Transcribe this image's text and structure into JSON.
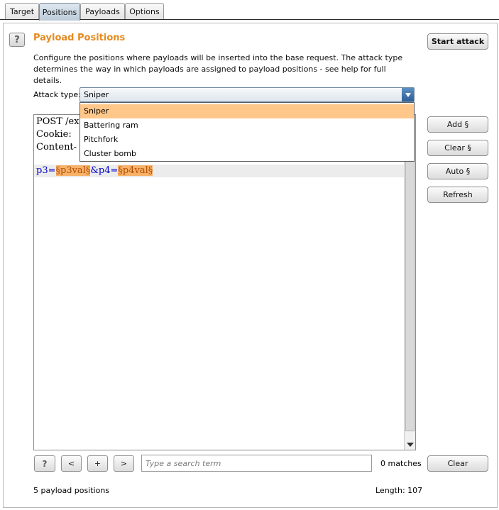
{
  "tabs": [
    {
      "label": "Target",
      "active": false
    },
    {
      "label": "Positions",
      "active": true
    },
    {
      "label": "Payloads",
      "active": false
    },
    {
      "label": "Options",
      "active": false
    }
  ],
  "panel": {
    "help_glyph": "?",
    "title": "Payload Positions",
    "description": "Configure the positions where payloads will be inserted into the base request. The attack type determines the way in which payloads are assigned to payload positions - see help for full details.",
    "start_attack_label": "Start attack"
  },
  "attack_type": {
    "label": "Attack type:",
    "selected": "Sniper",
    "options": [
      "Sniper",
      "Battering ram",
      "Pitchfork",
      "Cluster bomb"
    ]
  },
  "editor": {
    "lines": [
      "POST /ex",
      "Cookie:",
      "Content-"
    ],
    "param_line": {
      "p3_name": "p3=",
      "p3_value": "§p3val§",
      "p4_name": "&p4=",
      "p4_value": "§p4val§"
    }
  },
  "side_buttons": {
    "add": "Add §",
    "clear": "Clear §",
    "auto": "Auto §",
    "refresh": "Refresh"
  },
  "search_bar": {
    "help_glyph": "?",
    "prev": "<",
    "add": "+",
    "next": ">",
    "placeholder": "Type a search term",
    "matches": "0 matches",
    "clear": "Clear"
  },
  "footer": {
    "positions": "5 payload positions",
    "length": "Length: 107"
  },
  "colors": {
    "title_orange": "#e58a1f",
    "payload_highlight": "#f7b26a",
    "selected_option": "#ffc88a",
    "param_blue": "#0000cc"
  }
}
